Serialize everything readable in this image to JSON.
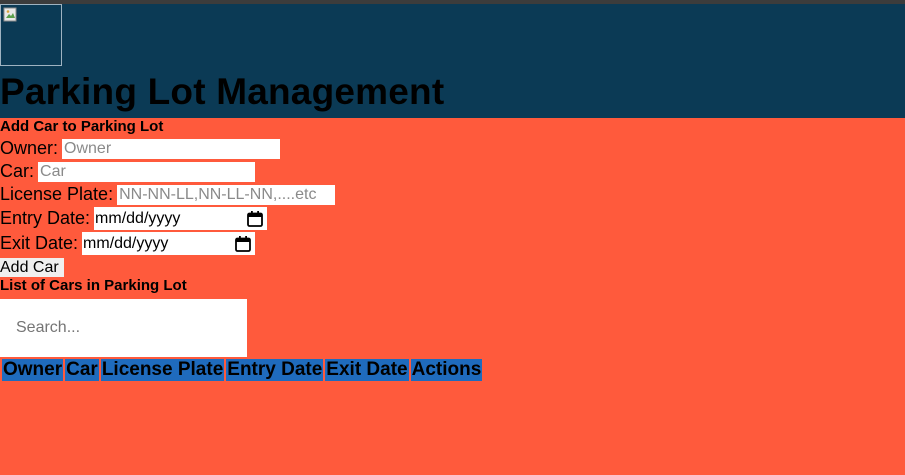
{
  "header": {
    "title": "Parking Lot Management",
    "logo_alt": "broken-image-icon"
  },
  "add_form": {
    "title": "Add Car to Parking Lot",
    "owner_label": "Owner:",
    "owner_placeholder": "Owner",
    "car_label": "Car:",
    "car_placeholder": "Car",
    "plate_label": "License Plate:",
    "plate_placeholder": "NN-NN-LL,NN-LL-NN,....etc",
    "entry_label": "Entry Date:",
    "entry_value": "mm/dd/yyyy",
    "exit_label": "Exit Date:",
    "exit_value": "mm/dd/yyyy",
    "submit_label": "Add Car"
  },
  "list": {
    "title": "List of Cars in Parking Lot",
    "search_placeholder": "Search...",
    "columns": [
      "Owner",
      "Car",
      "License Plate",
      "Entry Date",
      "Exit Date",
      "Actions"
    ],
    "rows": []
  },
  "colors": {
    "header_bg": "#0b3a55",
    "page_bg": "#ff5a3c",
    "table_header_bg": "#1f6bbd"
  }
}
